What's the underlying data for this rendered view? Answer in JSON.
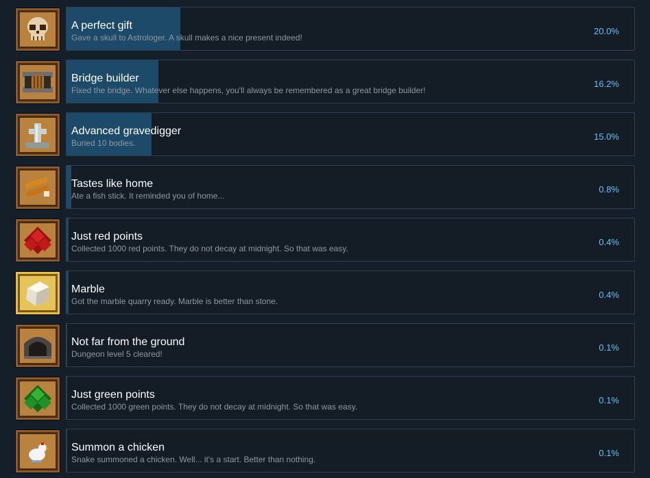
{
  "achievements": [
    {
      "title": "A perfect gift",
      "description": "Gave a skull to Astrologer. A skull makes a nice present indeed!",
      "percent": "20.0%",
      "fill_fraction": 0.2,
      "icon": "skull-icon"
    },
    {
      "title": "Bridge builder",
      "description": "Fixed the bridge. Whatever else happens, you'll always be remembered as a great bridge builder!",
      "percent": "16.2%",
      "fill_fraction": 0.162,
      "icon": "bridge-icon"
    },
    {
      "title": "Advanced gravedigger",
      "description": "Buried 10 bodies.",
      "percent": "15.0%",
      "fill_fraction": 0.15,
      "icon": "gravestone-icon"
    },
    {
      "title": "Tastes like home",
      "description": "Ate a fish stick. It reminded you of home...",
      "percent": "0.8%",
      "fill_fraction": 0.008,
      "icon": "fish-stick-icon"
    },
    {
      "title": "Just red points",
      "description": "Collected 1000 red points. They do not decay at midnight. So that was easy.",
      "percent": "0.4%",
      "fill_fraction": 0.004,
      "icon": "red-points-icon"
    },
    {
      "title": "Marble",
      "description": "Got the marble quarry ready. Marble is better than stone.",
      "percent": "0.4%",
      "fill_fraction": 0.004,
      "icon": "marble-icon"
    },
    {
      "title": "Not far from the ground",
      "description": "Dungeon level 5 cleared!",
      "percent": "0.1%",
      "fill_fraction": 0.001,
      "icon": "dungeon-icon"
    },
    {
      "title": "Just green points",
      "description": "Collected 1000 green points. They do not decay at midnight. So that was easy.",
      "percent": "0.1%",
      "fill_fraction": 0.001,
      "icon": "green-points-icon"
    },
    {
      "title": "Summon a chicken",
      "description": "Snake summoned a chicken. Well... it's a start. Better than nothing.",
      "percent": "0.1%",
      "fill_fraction": 0.001,
      "icon": "chicken-icon"
    }
  ]
}
